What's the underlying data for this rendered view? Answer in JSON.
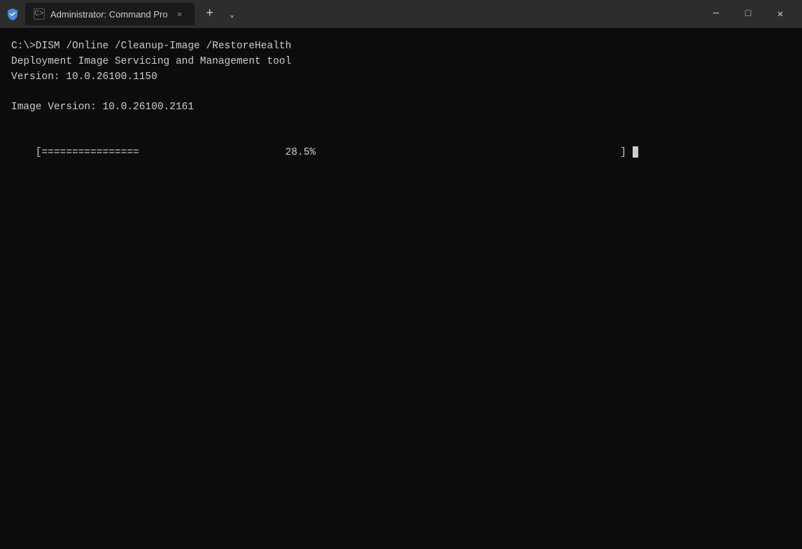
{
  "titlebar": {
    "app_title": "Administrator: Command Pro",
    "close_label": "✕",
    "minimize_label": "─",
    "maximize_label": "□",
    "new_tab_label": "+",
    "dropdown_label": "⌄",
    "tab_icon_label": "C>"
  },
  "terminal": {
    "line1": "C:\\>DISM /Online /Cleanup-Image /RestoreHealth",
    "line2": "",
    "line3": "Deployment Image Servicing and Management tool",
    "line4": "Version: 10.0.26100.1150",
    "line5": "",
    "line6": "Image Version: 10.0.26100.2161",
    "line7": "",
    "progress_prefix": "[================",
    "progress_spaces": "                        ",
    "progress_percent": "28.5%",
    "progress_spaces2": "                                                  ",
    "progress_suffix": "]"
  }
}
